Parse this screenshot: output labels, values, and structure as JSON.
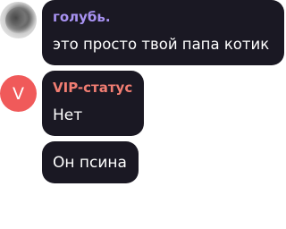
{
  "messages": [
    {
      "author": "голубь.",
      "text": "это просто твой папа котик",
      "author_color": "#a892f2",
      "avatar": "photo-avatar"
    },
    {
      "author": "VIP-статус",
      "text": "Нет",
      "author_color": "#f17d72",
      "avatar_letter": "V",
      "avatar_color": "#f05a5a"
    },
    {
      "text": "Он псина"
    }
  ],
  "colors": {
    "bubble_bg": "#1a1823",
    "text": "#ffffff",
    "page_bg": "#ffffff"
  }
}
